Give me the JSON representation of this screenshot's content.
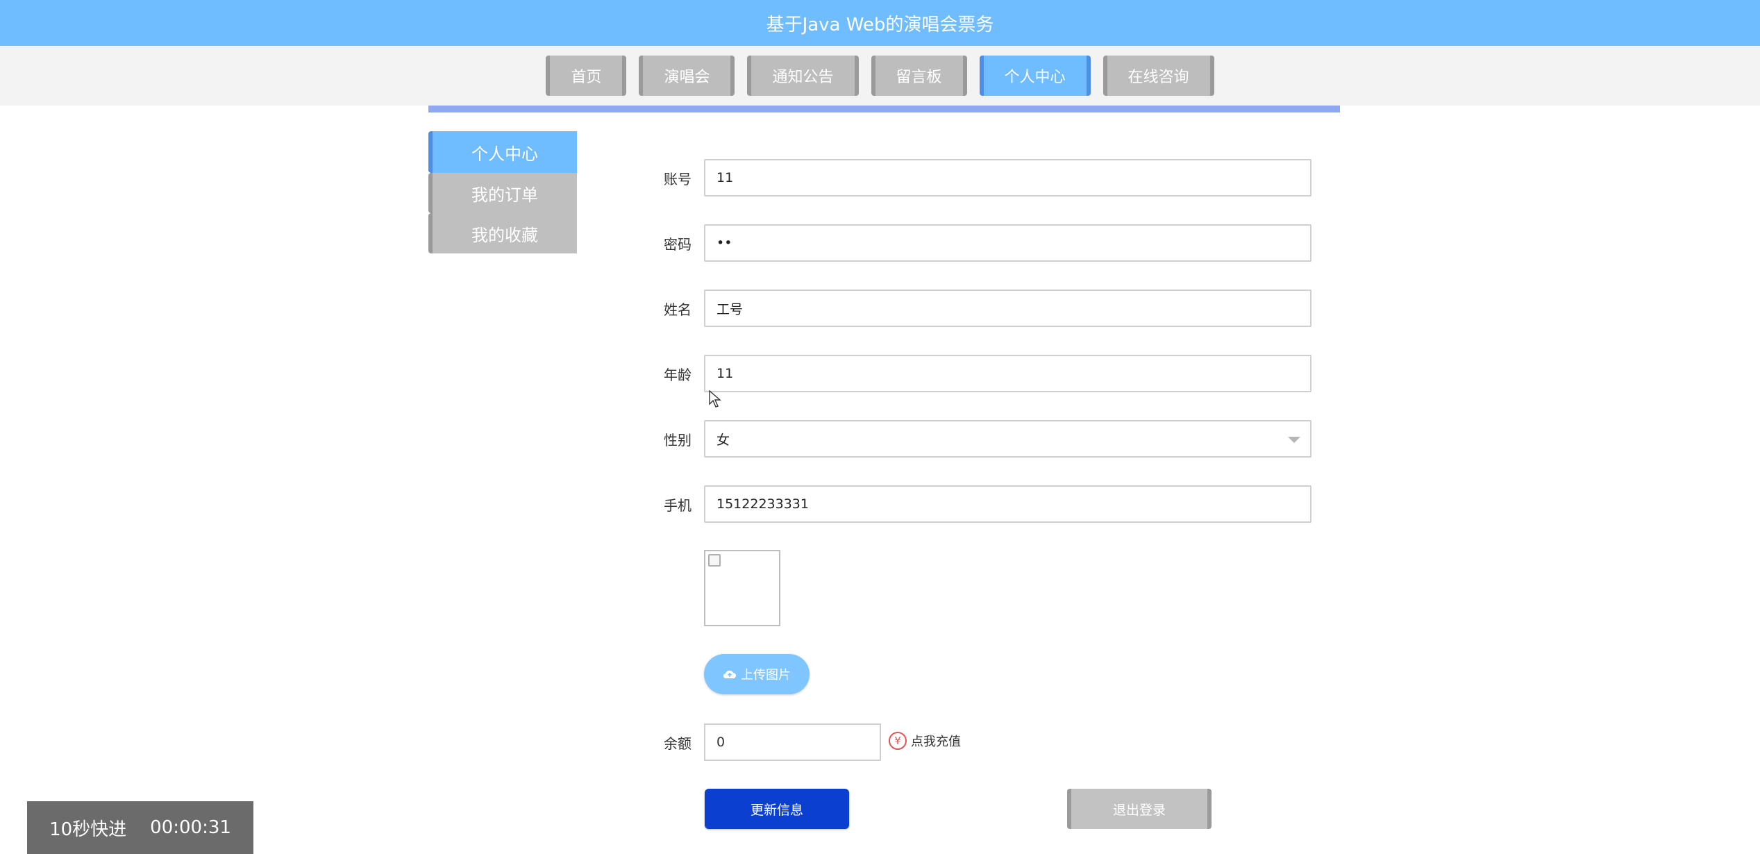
{
  "title": "基于Java Web的演唱会票务",
  "nav": {
    "items": [
      {
        "label": "首页"
      },
      {
        "label": "演唱会"
      },
      {
        "label": "通知公告"
      },
      {
        "label": "留言板"
      },
      {
        "label": "个人中心"
      },
      {
        "label": "在线咨询"
      }
    ],
    "active": "个人中心"
  },
  "sidebar": {
    "items": [
      {
        "label": "个人中心"
      },
      {
        "label": "我的订单"
      },
      {
        "label": "我的收藏"
      }
    ]
  },
  "form": {
    "account_label": "账号",
    "account_value": "11",
    "password_label": "密码",
    "password_value": "••",
    "name_label": "姓名",
    "name_value": "工号",
    "age_label": "年龄",
    "age_value": "11",
    "gender_label": "性别",
    "gender_value": "女",
    "phone_label": "手机",
    "phone_value": "15122233331",
    "upload_label": "上传图片",
    "balance_label": "余额",
    "balance_value": "0",
    "recharge_label": "点我充值",
    "update_label": "更新信息",
    "logout_label": "退出登录"
  },
  "overlay": {
    "speed_label": "10秒快进",
    "time": "00:00:31"
  },
  "colors": {
    "header": "#6fbcff",
    "primary": "#0b3fd0",
    "divider": "#8ea9f2"
  },
  "icons": {
    "upload": "cloud-upload-icon",
    "recharge": "yen-icon"
  }
}
